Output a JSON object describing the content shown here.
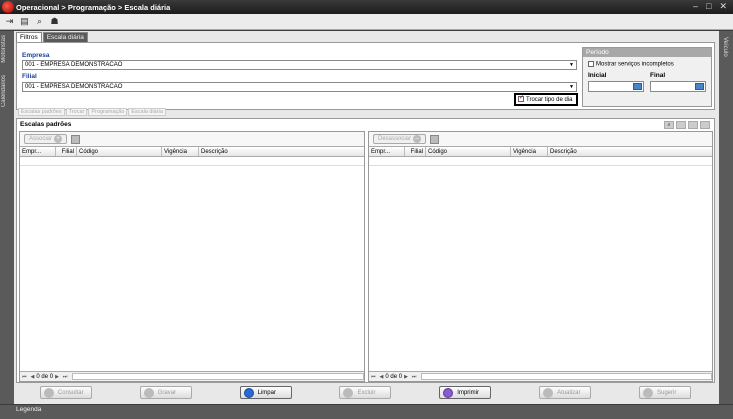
{
  "window": {
    "title": "Operacional > Programação > Escala diária",
    "controls": [
      "–",
      "□",
      "✕"
    ]
  },
  "toolbar": {
    "icons": [
      "exit-icon",
      "monitor-icon",
      "search-icon",
      "users-icon"
    ]
  },
  "left_rail": {
    "items": [
      "Motoristas",
      "Calendários"
    ]
  },
  "right_rail": {
    "label": "Veículo"
  },
  "tabs": [
    {
      "label": "Filtros",
      "active": true
    },
    {
      "label": "Escala diária",
      "active": false
    }
  ],
  "filters": {
    "empresa_label": "Empresa",
    "empresa_value": "001 - EMPRESA DEMONSTRACAO",
    "filial_label": "Filial",
    "filial_value": "001 - EMPRESA DEMONSTRACAO",
    "trocar_label": "Trocar tipo de dia",
    "trocar_checked": true
  },
  "periodo": {
    "title": "Período",
    "mostrar_label": "Mostrar serviços incompletos",
    "inicial_label": "Inicial",
    "final_label": "Final"
  },
  "subtabs": [
    "Escalas padrões",
    "Trocar",
    "Programação",
    "Escala diária"
  ],
  "section": {
    "title": "Escalas padrões"
  },
  "left_panel": {
    "button": "Associar",
    "columns": [
      "Empr...",
      "Filial",
      "Código",
      "Vigência",
      "Descrição"
    ],
    "pager_text": "0 de 0"
  },
  "right_panel": {
    "button": "Desassociar",
    "columns": [
      "Empr...",
      "Filial",
      "Código",
      "Vigência",
      "Descrição"
    ],
    "pager_text": "0 de 0"
  },
  "footer": {
    "buttons": [
      {
        "label": "Consultar",
        "active": false
      },
      {
        "label": "Gravar",
        "active": false
      },
      {
        "label": "Limpar",
        "active": true
      },
      {
        "label": "Excluir",
        "active": false
      },
      {
        "label": "Imprimir",
        "active": true
      },
      {
        "label": "Atualizar",
        "active": false
      },
      {
        "label": "Sugerir",
        "active": false
      }
    ]
  },
  "legend": {
    "label": "Legenda"
  },
  "colors": {
    "label_blue": "#1a3ea0",
    "highlight_border": "#000000"
  }
}
